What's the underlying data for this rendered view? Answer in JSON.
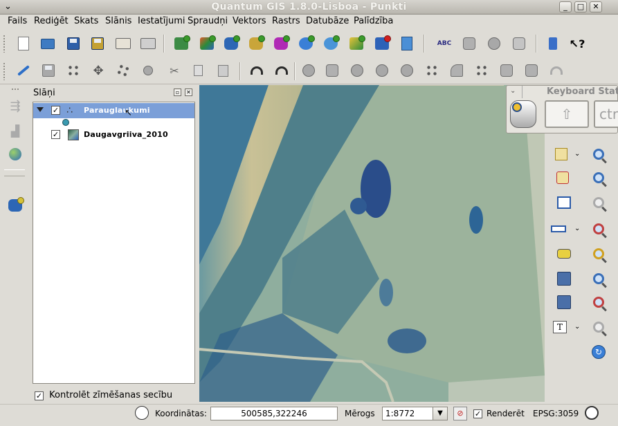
{
  "window": {
    "title": "Quantum GIS 1.8.0-Lisboa - Punkti"
  },
  "menu": [
    "Fails",
    "Rediģēt",
    "Skats",
    "Slānis",
    "Iestatījumi",
    "Spraudņi",
    "Vektors",
    "Rastrs",
    "Datubāze",
    "Palīdzība"
  ],
  "layers_panel": {
    "title": "Slāņi",
    "layers": [
      {
        "name": "Parauglaukumi",
        "checked": true,
        "selected": true
      },
      {
        "name": "Daugavgriiva_2010",
        "checked": true,
        "selected": false
      }
    ],
    "render_order_checkbox": "Kontrolēt zīmēšanas secību"
  },
  "keyboard_status": {
    "title": "Keyboard Status",
    "key_label": "ctrl"
  },
  "statusbar": {
    "coord_label": "Koordinātas:",
    "coord_value": "500585,322246",
    "scale_label": "Mērogs",
    "scale_value": "1:8772",
    "render_label": "Renderēt",
    "crs": "EPSG:3059"
  },
  "toolbar_icons": {
    "file": [
      "new-project-icon",
      "open-project-icon",
      "save-project-icon",
      "save-as-icon",
      "print-composer-icon",
      "print-icon"
    ],
    "layers": [
      "add-vector-icon",
      "add-raster-icon",
      "add-postgis-icon",
      "add-spatialite-icon",
      "add-mssql-icon",
      "add-wms-icon",
      "add-wfs-icon",
      "add-wcs-icon",
      "remove-layer-icon",
      "new-shapefile-icon"
    ],
    "plugins": [
      "label-icon",
      "plugin-1-icon",
      "plugin-2-icon",
      "plugin-3-icon",
      "bookmark-icon",
      "whats-this-icon"
    ],
    "edit": [
      "edit-pencil-icon",
      "save-edits-icon",
      "add-feature-icon",
      "move-feature-icon",
      "node-tool-icon",
      "delete-selected-icon",
      "cut-icon",
      "copy-icon",
      "paste-icon",
      "undo-icon",
      "redo-icon",
      "simplify-icon",
      "add-ring-icon",
      "add-part-icon",
      "delete-ring-icon",
      "delete-part-icon",
      "reshape-icon",
      "offset-curve-icon",
      "split-icon",
      "merge-features-icon",
      "merge-attributes-icon",
      "rotate-symbol-icon"
    ]
  }
}
